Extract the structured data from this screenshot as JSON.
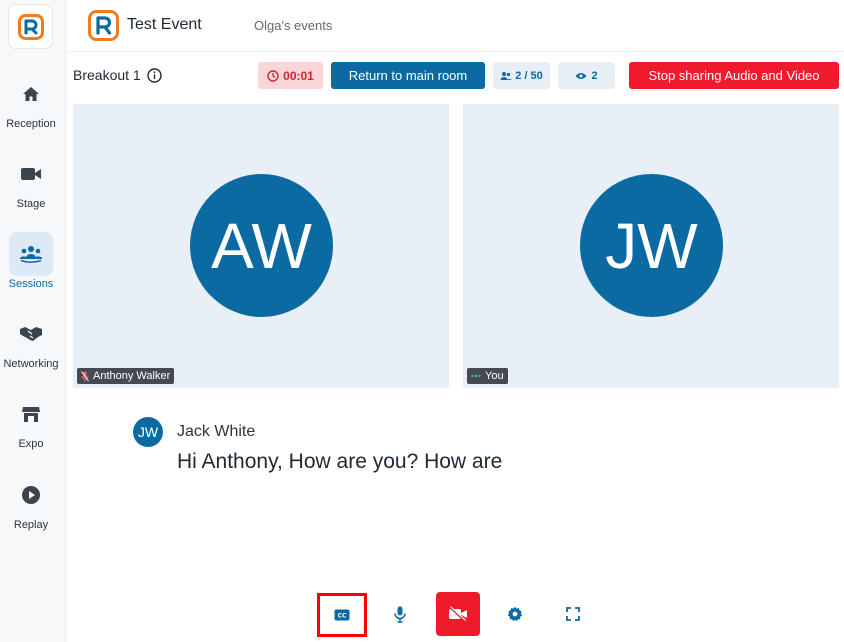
{
  "app": {
    "logo_letter": "R",
    "event_title": "Test Event",
    "event_owner": "Olga's events"
  },
  "sidebar": {
    "items": [
      {
        "label": "Reception",
        "icon": "home-icon",
        "active": false
      },
      {
        "label": "Stage",
        "icon": "video-camera-icon",
        "active": false
      },
      {
        "label": "Sessions",
        "icon": "people-group-icon",
        "active": true
      },
      {
        "label": "Networking",
        "icon": "handshake-icon",
        "active": false
      },
      {
        "label": "Expo",
        "icon": "store-icon",
        "active": false
      },
      {
        "label": "Replay",
        "icon": "play-circle-icon",
        "active": false
      }
    ]
  },
  "toolbar": {
    "room_title": "Breakout 1",
    "timer": "00:01",
    "return_label": "Return to main room",
    "participant_count": "2 / 50",
    "viewer_count": "2",
    "stop_label": "Stop sharing Audio and Video"
  },
  "tiles": [
    {
      "initials": "AW",
      "name": "Anthony Walker",
      "status_icon": "mic-muted-icon"
    },
    {
      "initials": "JW",
      "name": "You",
      "status_icon": "speaking-dots-icon"
    }
  ],
  "caption": {
    "initials": "JW",
    "speaker": "Jack White",
    "text": "Hi Anthony, How are you? How are"
  },
  "colors": {
    "brand": "#0b6aa2",
    "danger": "#ef1b2d",
    "accent_orange": "#f07c22",
    "tile_bg": "#e8eff7"
  }
}
